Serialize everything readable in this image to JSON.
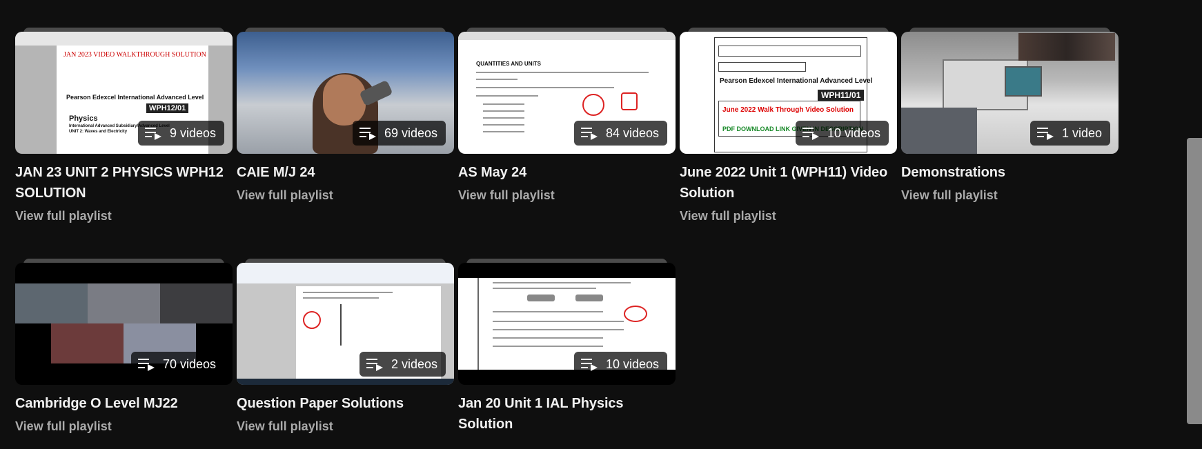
{
  "playlists": [
    {
      "title": "JAN 23 UNIT 2 PHYSICS WPH12 SOLUTION",
      "count": "9 videos",
      "link": "View full playlist",
      "thumb_text": [
        "JAN 2023 VIDEO WALKTHROUGH SOLUTION",
        "Pearson Edexcel International Advanced Level",
        "WPH12/01",
        "Physics",
        "International Advanced Subsidiary/Advanced Level",
        "UNIT 2: Waves and Electricity"
      ]
    },
    {
      "title": "CAIE M/J 24",
      "count": "69 videos",
      "link": "View full playlist"
    },
    {
      "title": "AS May 24",
      "count": "84 videos",
      "link": "View full playlist",
      "thumb_text": [
        "QUANTITIES AND UNITS"
      ]
    },
    {
      "title": "June 2022 Unit 1 (WPH11) Video Solution",
      "count": "10 videos",
      "link": "View full playlist",
      "thumb_text": [
        "Pearson Edexcel International Advanced Level",
        "WPH11/01",
        "June 2022 Walk Through Video Solution",
        "PDF DOWNLOAD LINK GIVEN IN DESCRIPTION"
      ]
    },
    {
      "title": "Demonstrations",
      "count": "1 video",
      "link": "View full playlist"
    },
    {
      "title": "Cambridge O Level MJ22",
      "count": "70 videos",
      "link": "View full playlist"
    },
    {
      "title": "Question Paper Solutions",
      "count": "2 videos",
      "link": "View full playlist"
    },
    {
      "title": "Jan 20 Unit 1 IAL Physics Solution",
      "count": "10 videos",
      "link": "View full playlist"
    }
  ],
  "icons": {
    "playlist": "playlist-icon"
  },
  "colors": {
    "background": "#0f0f0f",
    "title": "#f1f1f1",
    "link": "#aaaaaa"
  }
}
